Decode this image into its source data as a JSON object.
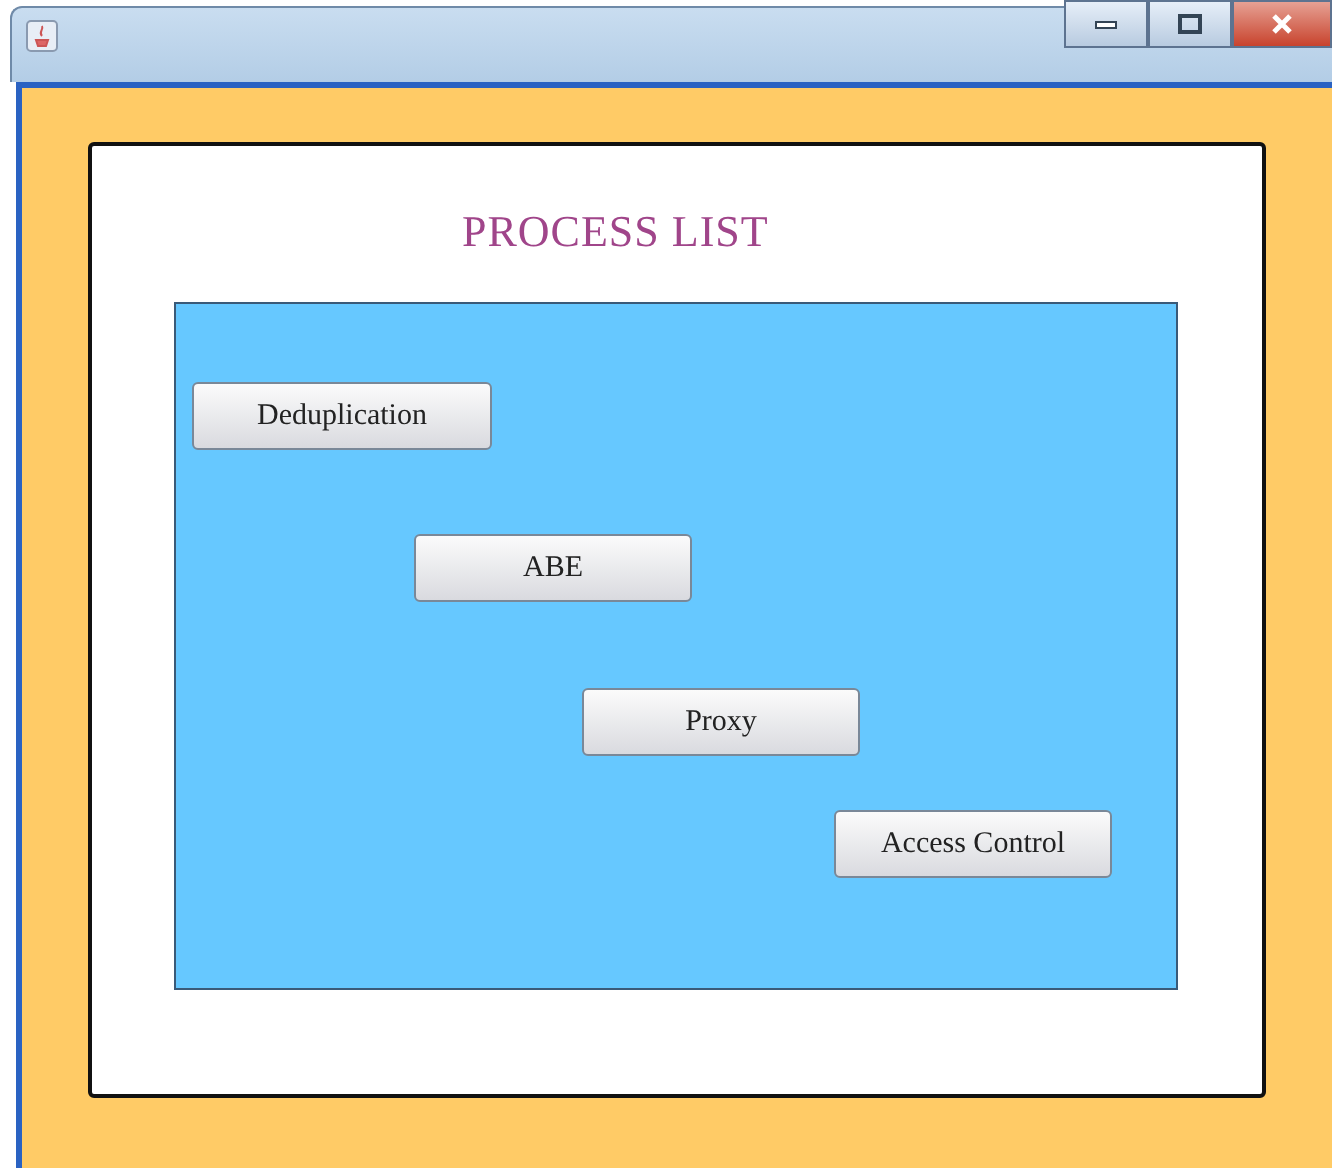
{
  "heading": "PROCESS LIST",
  "buttons": [
    {
      "label": "Deduplication"
    },
    {
      "label": "ABE"
    },
    {
      "label": "Proxy"
    },
    {
      "label": "Access Control"
    }
  ]
}
